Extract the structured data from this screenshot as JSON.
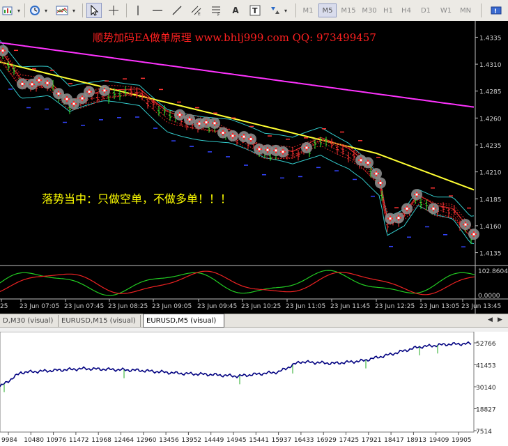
{
  "toolbar": {
    "timeframes": [
      "M1",
      "M5",
      "M15",
      "M30",
      "H1",
      "H4",
      "D1",
      "W1",
      "MN"
    ],
    "active_timeframe": "M5",
    "text_tool": "A",
    "text_label_tool": "T"
  },
  "chart": {
    "banner": "顺势加码EA做单原理  www.bhlj999.com  QQ: 973499457",
    "annotation": "落势当中：只做空单，不做多单！！！",
    "price_ticks": [
      "1.4335",
      "1.4310",
      "1.4285",
      "1.4260",
      "1.4235",
      "1.4210",
      "1.4185",
      "1.4160",
      "1.4135"
    ],
    "oscillator_ticks": [
      "102.8604",
      "0.0000"
    ],
    "time_ticks": [
      "25",
      "23 Jun 07:05",
      "23 Jun 07:45",
      "23 Jun 08:25",
      "23 Jun 09:05",
      "23 Jun 09:45",
      "23 Jun 10:25",
      "23 Jun 11:05",
      "23 Jun 11:45",
      "23 Jun 12:25",
      "23 Jun 13:05",
      "23 Jun 13:45"
    ],
    "colors": {
      "ma_slow": "#ff33ff",
      "ma_fast": "#ffff33",
      "bands": "#33cccc",
      "trend": "#ff3333",
      "bull": "#33ee33",
      "bear": "#ff3333",
      "support": "#3344ff",
      "osc_a": "#22cc22",
      "osc_b": "#ee2222"
    }
  },
  "tabs": {
    "items": [
      "D,M30 (visual)",
      "EURUSD,M15 (visual)",
      "EURUSD,M5 (visual)"
    ],
    "active": "EURUSD,M5 (visual)"
  },
  "equity": {
    "y_ticks": [
      "52766",
      "41453",
      "30140",
      "18827",
      "7514"
    ],
    "x_ticks": [
      "9984",
      "10480",
      "10976",
      "11472",
      "11968",
      "12464",
      "12960",
      "13456",
      "13952",
      "14449",
      "14945",
      "15441",
      "15937",
      "16433",
      "16929",
      "17425",
      "17921",
      "18417",
      "18913",
      "19409",
      "19905"
    ],
    "line_color": "#000080"
  }
}
